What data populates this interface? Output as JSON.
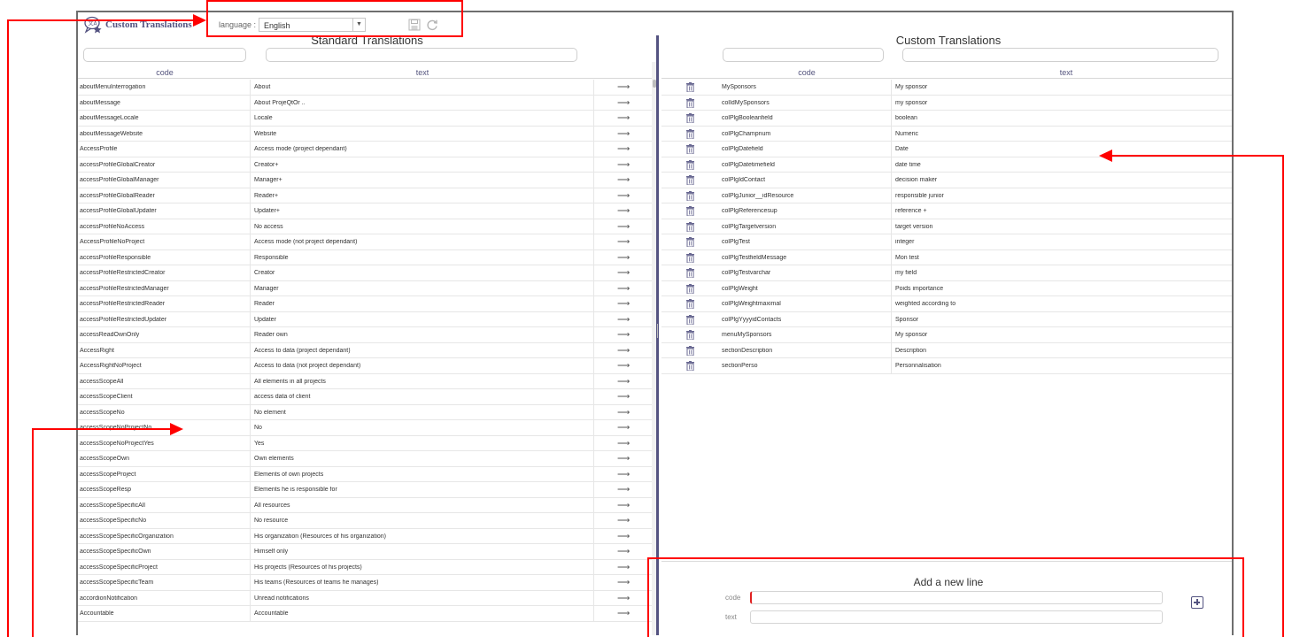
{
  "header": {
    "app_title": "Custom Translations",
    "language_label": "language :",
    "language_value": "English",
    "icons": [
      "translation-logo-icon",
      "save-icon",
      "refresh-icon"
    ]
  },
  "standard": {
    "title": "Standard Translations",
    "col_code": "code",
    "col_text": "text",
    "action_glyph": "⟶",
    "rows": [
      {
        "code": "aboutMenuInterrogation",
        "text": "About"
      },
      {
        "code": "aboutMessage",
        "text": "About ProjeQtOr .."
      },
      {
        "code": "aboutMessageLocale",
        "text": "Locale"
      },
      {
        "code": "aboutMessageWebsite",
        "text": "Website"
      },
      {
        "code": "AccessProfile",
        "text": "Access mode (project dependant)"
      },
      {
        "code": "accessProfileGlobalCreator",
        "text": "Creator+"
      },
      {
        "code": "accessProfileGlobalManager",
        "text": "Manager+"
      },
      {
        "code": "accessProfileGlobalReader",
        "text": "Reader+"
      },
      {
        "code": "accessProfileGlobalUpdater",
        "text": "Updater+"
      },
      {
        "code": "accessProfileNoAccess",
        "text": "No access"
      },
      {
        "code": "AccessProfileNoProject",
        "text": "Access mode (not project dependant)"
      },
      {
        "code": "accessProfileResponsible",
        "text": "Responsible"
      },
      {
        "code": "accessProfileRestrictedCreator",
        "text": "Creator"
      },
      {
        "code": "accessProfileRestrictedManager",
        "text": "Manager"
      },
      {
        "code": "accessProfileRestrictedReader",
        "text": "Reader"
      },
      {
        "code": "accessProfileRestrictedUpdater",
        "text": "Updater"
      },
      {
        "code": "accessReadOwnOnly",
        "text": "Reader own"
      },
      {
        "code": "AccessRight",
        "text": "Access to data (project dependant)"
      },
      {
        "code": "AccessRightNoProject",
        "text": "Access to data (not project dependant)"
      },
      {
        "code": "accessScopeAll",
        "text": "All elements in all projects"
      },
      {
        "code": "accessScopeClient",
        "text": "access data of client"
      },
      {
        "code": "accessScopeNo",
        "text": "No element"
      },
      {
        "code": "accessScopeNoProjectNo",
        "text": "No"
      },
      {
        "code": "accessScopeNoProjectYes",
        "text": "Yes"
      },
      {
        "code": "accessScopeOwn",
        "text": "Own elements"
      },
      {
        "code": "accessScopeProject",
        "text": "Elements of own projects"
      },
      {
        "code": "accessScopeResp",
        "text": "Elements he is responsible for"
      },
      {
        "code": "accessScopeSpecificAll",
        "text": "All resources"
      },
      {
        "code": "accessScopeSpecificNo",
        "text": "No resource"
      },
      {
        "code": "accessScopeSpecificOrganization",
        "text": "His organization (Resources of his organization)"
      },
      {
        "code": "accessScopeSpecificOwn",
        "text": "Himself only"
      },
      {
        "code": "accessScopeSpecificProject",
        "text": "His projects (Resources of his projects)"
      },
      {
        "code": "accessScopeSpecificTeam",
        "text": "His teams (Resources of teams he manages)"
      },
      {
        "code": "accordionNotification",
        "text": "Unread notifications"
      },
      {
        "code": "Accountable",
        "text": "Accountable"
      }
    ]
  },
  "custom": {
    "title": "Custom Translations",
    "col_code": "code",
    "col_text": "text",
    "rows": [
      {
        "code": "MySponsors",
        "text": "My sponsor"
      },
      {
        "code": "colIdMySponsors",
        "text": "my sponsor"
      },
      {
        "code": "colPlgBooleanfield",
        "text": "boolean"
      },
      {
        "code": "colPlgChampnum",
        "text": "Numeric"
      },
      {
        "code": "colPlgDatefield",
        "text": "Date"
      },
      {
        "code": "colPlgDatetimefield",
        "text": "date time"
      },
      {
        "code": "colPlgIdContact",
        "text": "decision maker"
      },
      {
        "code": "colPlgJunior__idResource",
        "text": "responsible junior"
      },
      {
        "code": "colPlgReferencesup",
        "text": "reference +"
      },
      {
        "code": "colPlgTargetversion",
        "text": "target version"
      },
      {
        "code": "colPlgTest",
        "text": "integer"
      },
      {
        "code": "colPlgTestfieldMessage",
        "text": "Mon test"
      },
      {
        "code": "colPlgTestvarchar",
        "text": "my field"
      },
      {
        "code": "colPlgWeight",
        "text": "Poids importance"
      },
      {
        "code": "colPlgWeightmaximal",
        "text": "weighted according to"
      },
      {
        "code": "colPlgYyyyidContacts",
        "text": "Sponsor"
      },
      {
        "code": "menuMySponsors",
        "text": "My sponsor"
      },
      {
        "code": "sectionDescription",
        "text": "Description"
      },
      {
        "code": "sectionPerso",
        "text": "Personnalisation"
      }
    ]
  },
  "add_line": {
    "title": "Add a new line",
    "code_label": "code",
    "text_label": "text",
    "code_value": "",
    "text_value": ""
  },
  "colors": {
    "accent": "#545381",
    "annotation": "#ff0000"
  }
}
